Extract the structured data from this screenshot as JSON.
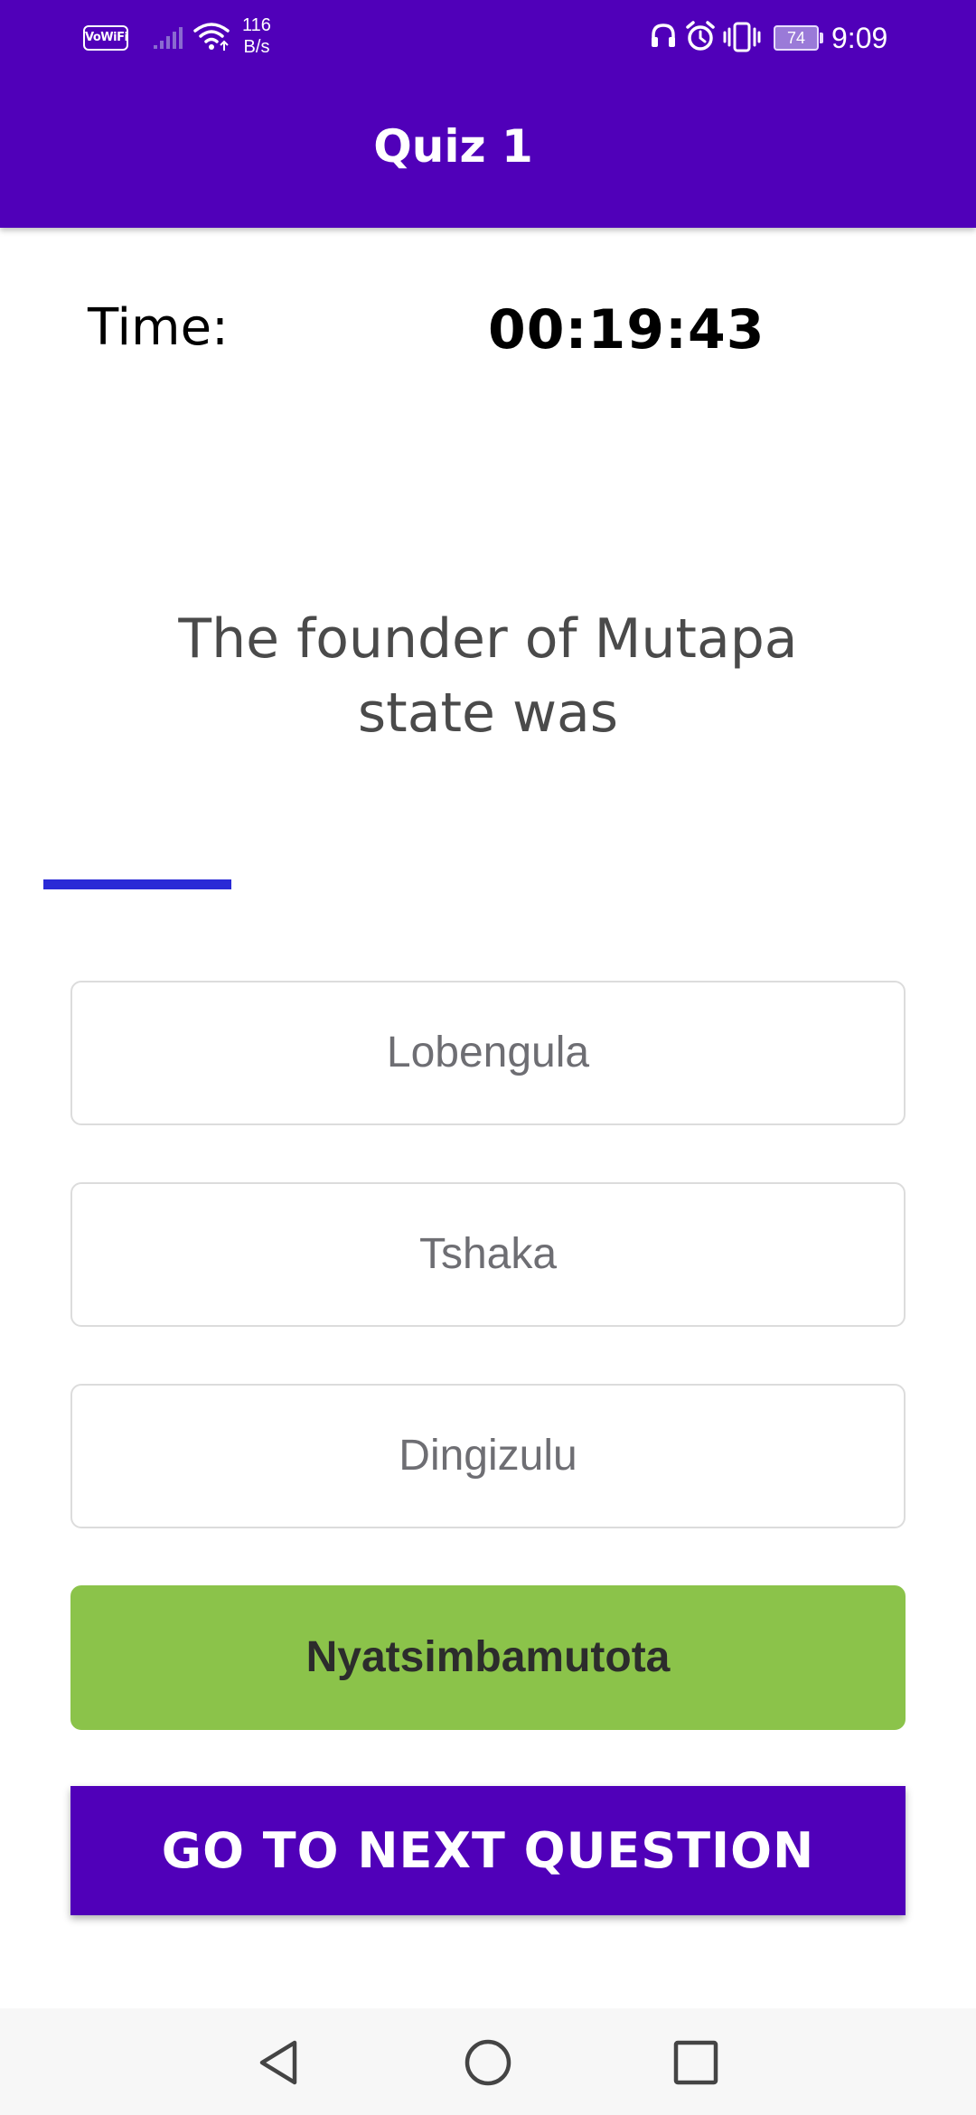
{
  "status_bar": {
    "vowifi": "VoWiFi",
    "net_speed_value": "116",
    "net_speed_unit": "B/s",
    "battery": "74",
    "time": "9:09"
  },
  "app_bar": {
    "title": "Quiz 1",
    "color": "#5000b9"
  },
  "timer": {
    "label": "Time:",
    "value": "00:19:43"
  },
  "question": {
    "text": "The founder of Mutapa state was"
  },
  "progress": {
    "color": "#2a2ad6"
  },
  "options": [
    {
      "label": "Lobengula",
      "state": "default"
    },
    {
      "label": "Tshaka",
      "state": "default"
    },
    {
      "label": "Dingizulu",
      "state": "default"
    },
    {
      "label": "Nyatsimbamutota",
      "state": "correct",
      "color": "#8bc34a"
    }
  ],
  "next_button": {
    "label": "GO TO NEXT QUESTION"
  },
  "nav_bar": {
    "icons": [
      "back-icon",
      "home-icon",
      "recents-icon"
    ]
  }
}
